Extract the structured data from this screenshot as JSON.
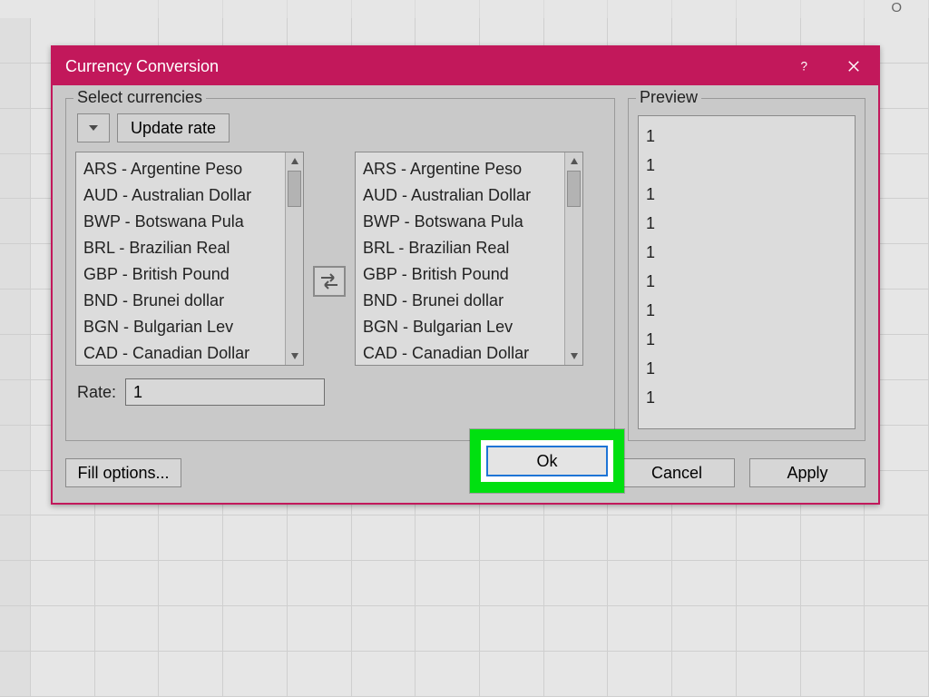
{
  "spreadsheet": {
    "visible_column_header": "O"
  },
  "dialog": {
    "title": "Currency Conversion",
    "select_currencies": {
      "legend": "Select currencies",
      "update_rate_label": "Update rate",
      "currencies": [
        "ARS - Argentine Peso",
        "AUD - Australian Dollar",
        "BWP - Botswana Pula",
        "BRL - Brazilian Real",
        "GBP - British Pound",
        "BND - Brunei dollar",
        "BGN - Bulgarian Lev",
        "CAD - Canadian Dollar"
      ],
      "rate_label": "Rate:",
      "rate_value": "1"
    },
    "preview": {
      "legend": "Preview",
      "values": [
        "1",
        "1",
        "1",
        "1",
        "1",
        "1",
        "1",
        "1",
        "1",
        "1"
      ]
    },
    "buttons": {
      "fill_options": "Fill options...",
      "ok": "Ok",
      "cancel": "Cancel",
      "apply": "Apply"
    }
  }
}
